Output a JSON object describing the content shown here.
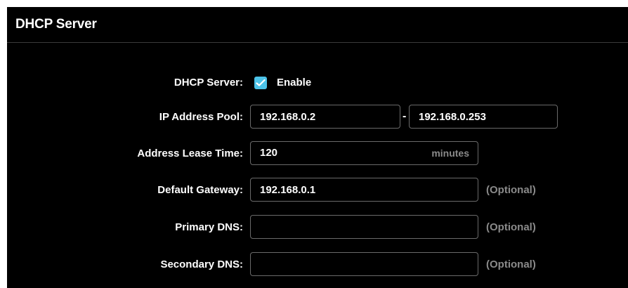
{
  "panel": {
    "title": "DHCP Server"
  },
  "dhcp_server": {
    "label": "DHCP Server:",
    "checkbox_label": "Enable",
    "enabled": true
  },
  "ip_pool": {
    "label": "IP Address Pool:",
    "start": "192.168.0.2",
    "separator": "-",
    "end": "192.168.0.253"
  },
  "lease_time": {
    "label": "Address Lease Time:",
    "value": "120",
    "unit": "minutes"
  },
  "default_gateway": {
    "label": "Default Gateway:",
    "value": "192.168.0.1",
    "hint": "(Optional)"
  },
  "primary_dns": {
    "label": "Primary DNS:",
    "value": "",
    "hint": "(Optional)"
  },
  "secondary_dns": {
    "label": "Secondary DNS:",
    "value": "",
    "hint": "(Optional)"
  },
  "colors": {
    "background": "#000000",
    "checkbox_accent": "#4cc3e8",
    "hint_text": "#8a8a8a",
    "field_border": "#6a6a6a"
  },
  "icons": {
    "checkbox": "checkmark-icon"
  }
}
